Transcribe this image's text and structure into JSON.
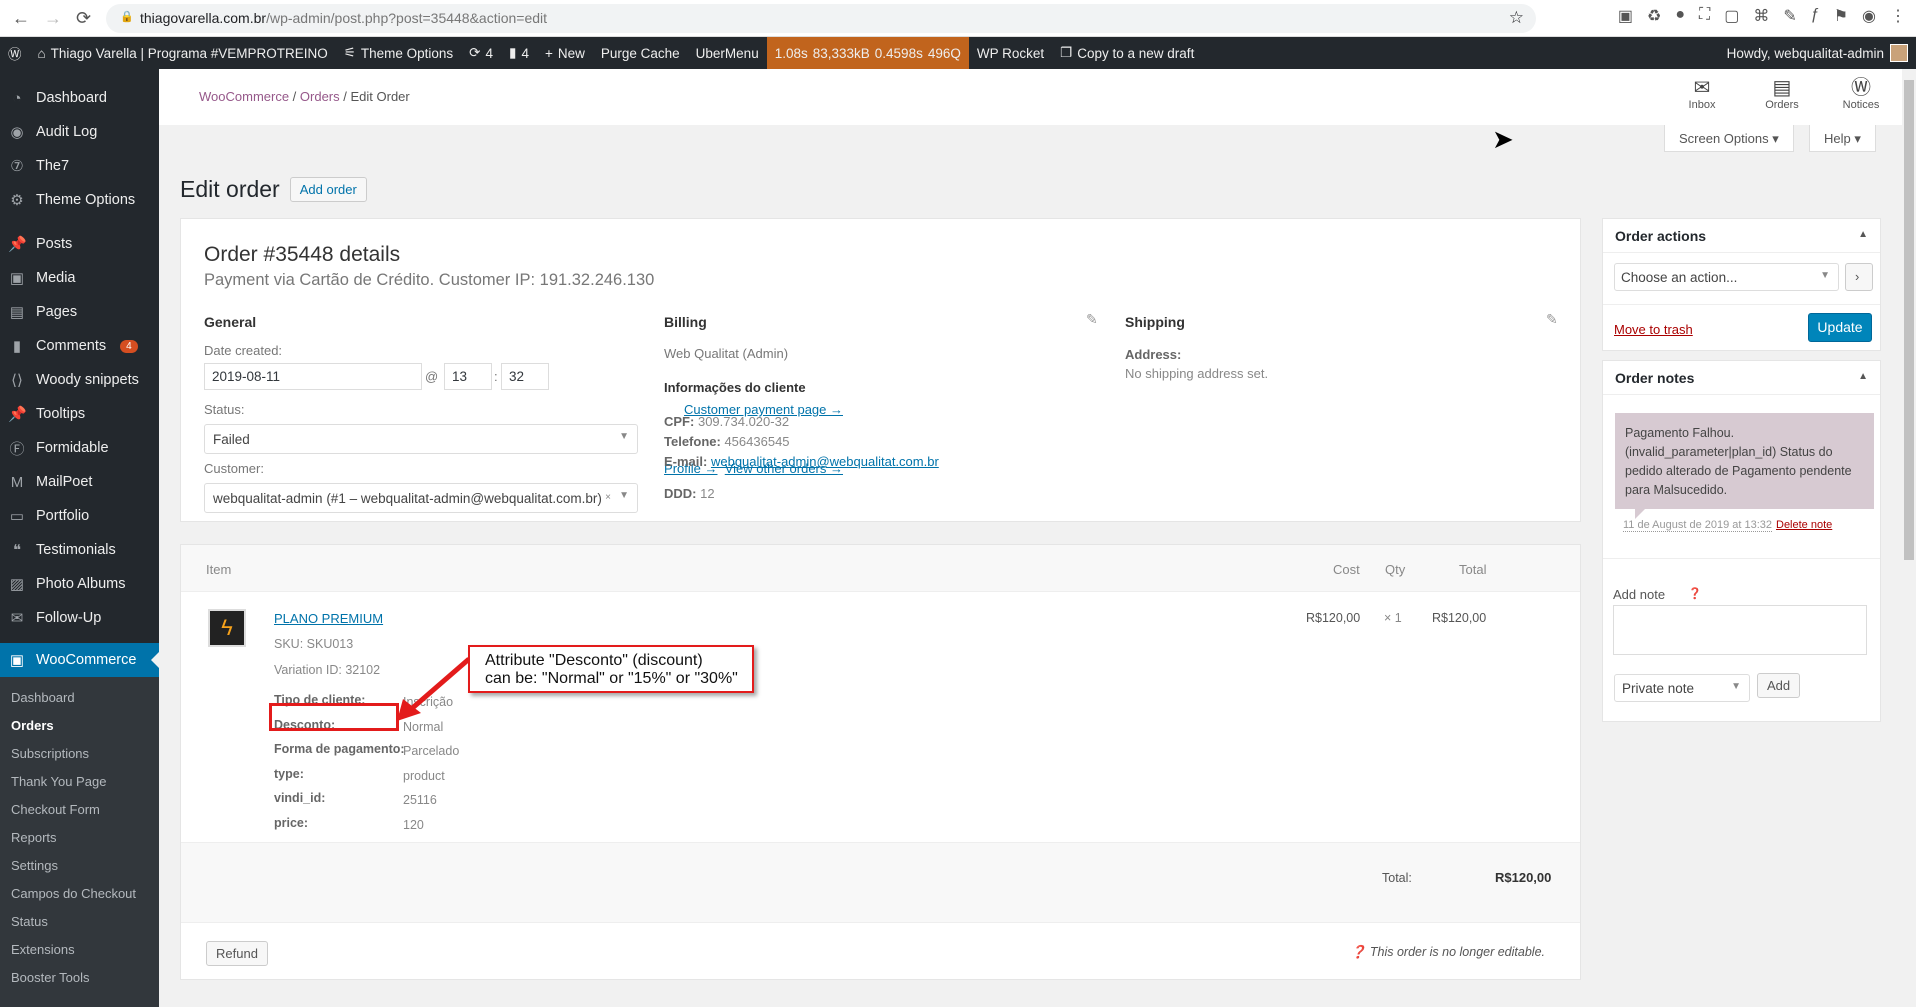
{
  "browser": {
    "url_host": "thiagovarella.com.br",
    "url_path": "/wp-admin/post.php?post=35448&action=edit"
  },
  "adminbar": {
    "site": "Thiago Varella | Programa #VEMPROTREINO",
    "theme_options": "Theme Options",
    "updates": "4",
    "comments": "4",
    "new": "New",
    "purge": "Purge Cache",
    "ubermenu": "UberMenu",
    "perf": [
      "1.08s",
      "83,333kB",
      "0.4598s",
      "496Q"
    ],
    "rocket": "WP Rocket",
    "copy": "Copy to a new draft",
    "howdy": "Howdy, webqualitat-admin"
  },
  "sidebar": {
    "items": [
      "Dashboard",
      "Audit Log",
      "The7",
      "Theme Options",
      "Posts",
      "Media",
      "Pages",
      "Comments",
      "Woody snippets",
      "Tooltips",
      "Formidable",
      "MailPoet",
      "Portfolio",
      "Testimonials",
      "Photo Albums",
      "Follow-Up"
    ],
    "comments_badge": "4",
    "woocommerce": "WooCommerce",
    "sub": [
      "Dashboard",
      "Orders",
      "Subscriptions",
      "Thank You Page",
      "Checkout Form",
      "Reports",
      "Settings",
      "Campos do Checkout",
      "Status",
      "Extensions",
      "Booster Tools"
    ]
  },
  "header": {
    "crumb": [
      "WooCommerce",
      "Orders",
      "Edit Order"
    ],
    "icons": [
      "Inbox",
      "Orders",
      "Notices"
    ],
    "screen_options": "Screen Options",
    "help": "Help"
  },
  "page": {
    "title": "Edit order",
    "add": "Add order"
  },
  "order": {
    "title": "Order #35448 details",
    "subtitle": "Payment via Cartão de Crédito. Customer IP: 191.32.246.130",
    "general": "General",
    "date_label": "Date created:",
    "date": "2019-08-11",
    "at": "@",
    "hour": "13",
    "minute": "32",
    "status_label": "Status:",
    "payment_link": "Customer payment page →",
    "status": "Failed",
    "customer_label": "Customer:",
    "profile": "Profile →",
    "other_orders": "View other orders →",
    "customer": "webqualitat-admin (#1 – webqualitat-admin@webqualitat.com.br)",
    "billing": "Billing",
    "billing_name": "Web Qualitat (Admin)",
    "info": "Informações do cliente",
    "cpf_l": "CPF:",
    "cpf": "309.734.020-32",
    "tel_l": "Telefone:",
    "tel": "456436545",
    "email_l": "E-mail:",
    "email": "webqualitat-admin@webqualitat.com.br",
    "ddd_l": "DDD:",
    "ddd": "12",
    "shipping": "Shipping",
    "address_l": "Address:",
    "address": "No shipping address set."
  },
  "items": {
    "headers": [
      "Item",
      "Cost",
      "Qty",
      "Total"
    ],
    "name": "PLANO PREMIUM",
    "sku": "SKU: SKU013",
    "variation": "Variation ID: 32102",
    "meta": [
      [
        "Tipo de cliente:",
        "Inscrição"
      ],
      [
        "Desconto:",
        "Normal"
      ],
      [
        "Forma de pagamento:",
        "Parcelado"
      ],
      [
        "type:",
        "product"
      ],
      [
        "vindi_id:",
        "25116"
      ],
      [
        "price:",
        "120"
      ]
    ],
    "cost": "R$120,00",
    "qty": "× 1",
    "total": "R$120,00",
    "total_label": "Total:",
    "grand": "R$120,00",
    "refund": "Refund",
    "not_editable": "This order is no longer editable."
  },
  "annotation": {
    "line1": "Attribute \"Desconto\" (discount)",
    "line2": "can be: \"Normal\" or \"15%\" or \"30%\""
  },
  "actions": {
    "title": "Order actions",
    "choose": "Choose an action...",
    "trash": "Move to trash",
    "update": "Update"
  },
  "notes": {
    "title": "Order notes",
    "note": "Pagamento Falhou. (invalid_parameter|plan_id) Status do pedido alterado de Pagamento pendente para Malsucedido.",
    "date": "11 de August de 2019 at 13:32",
    "delete": "Delete note",
    "add_label": "Add note",
    "type": "Private note",
    "add": "Add"
  }
}
